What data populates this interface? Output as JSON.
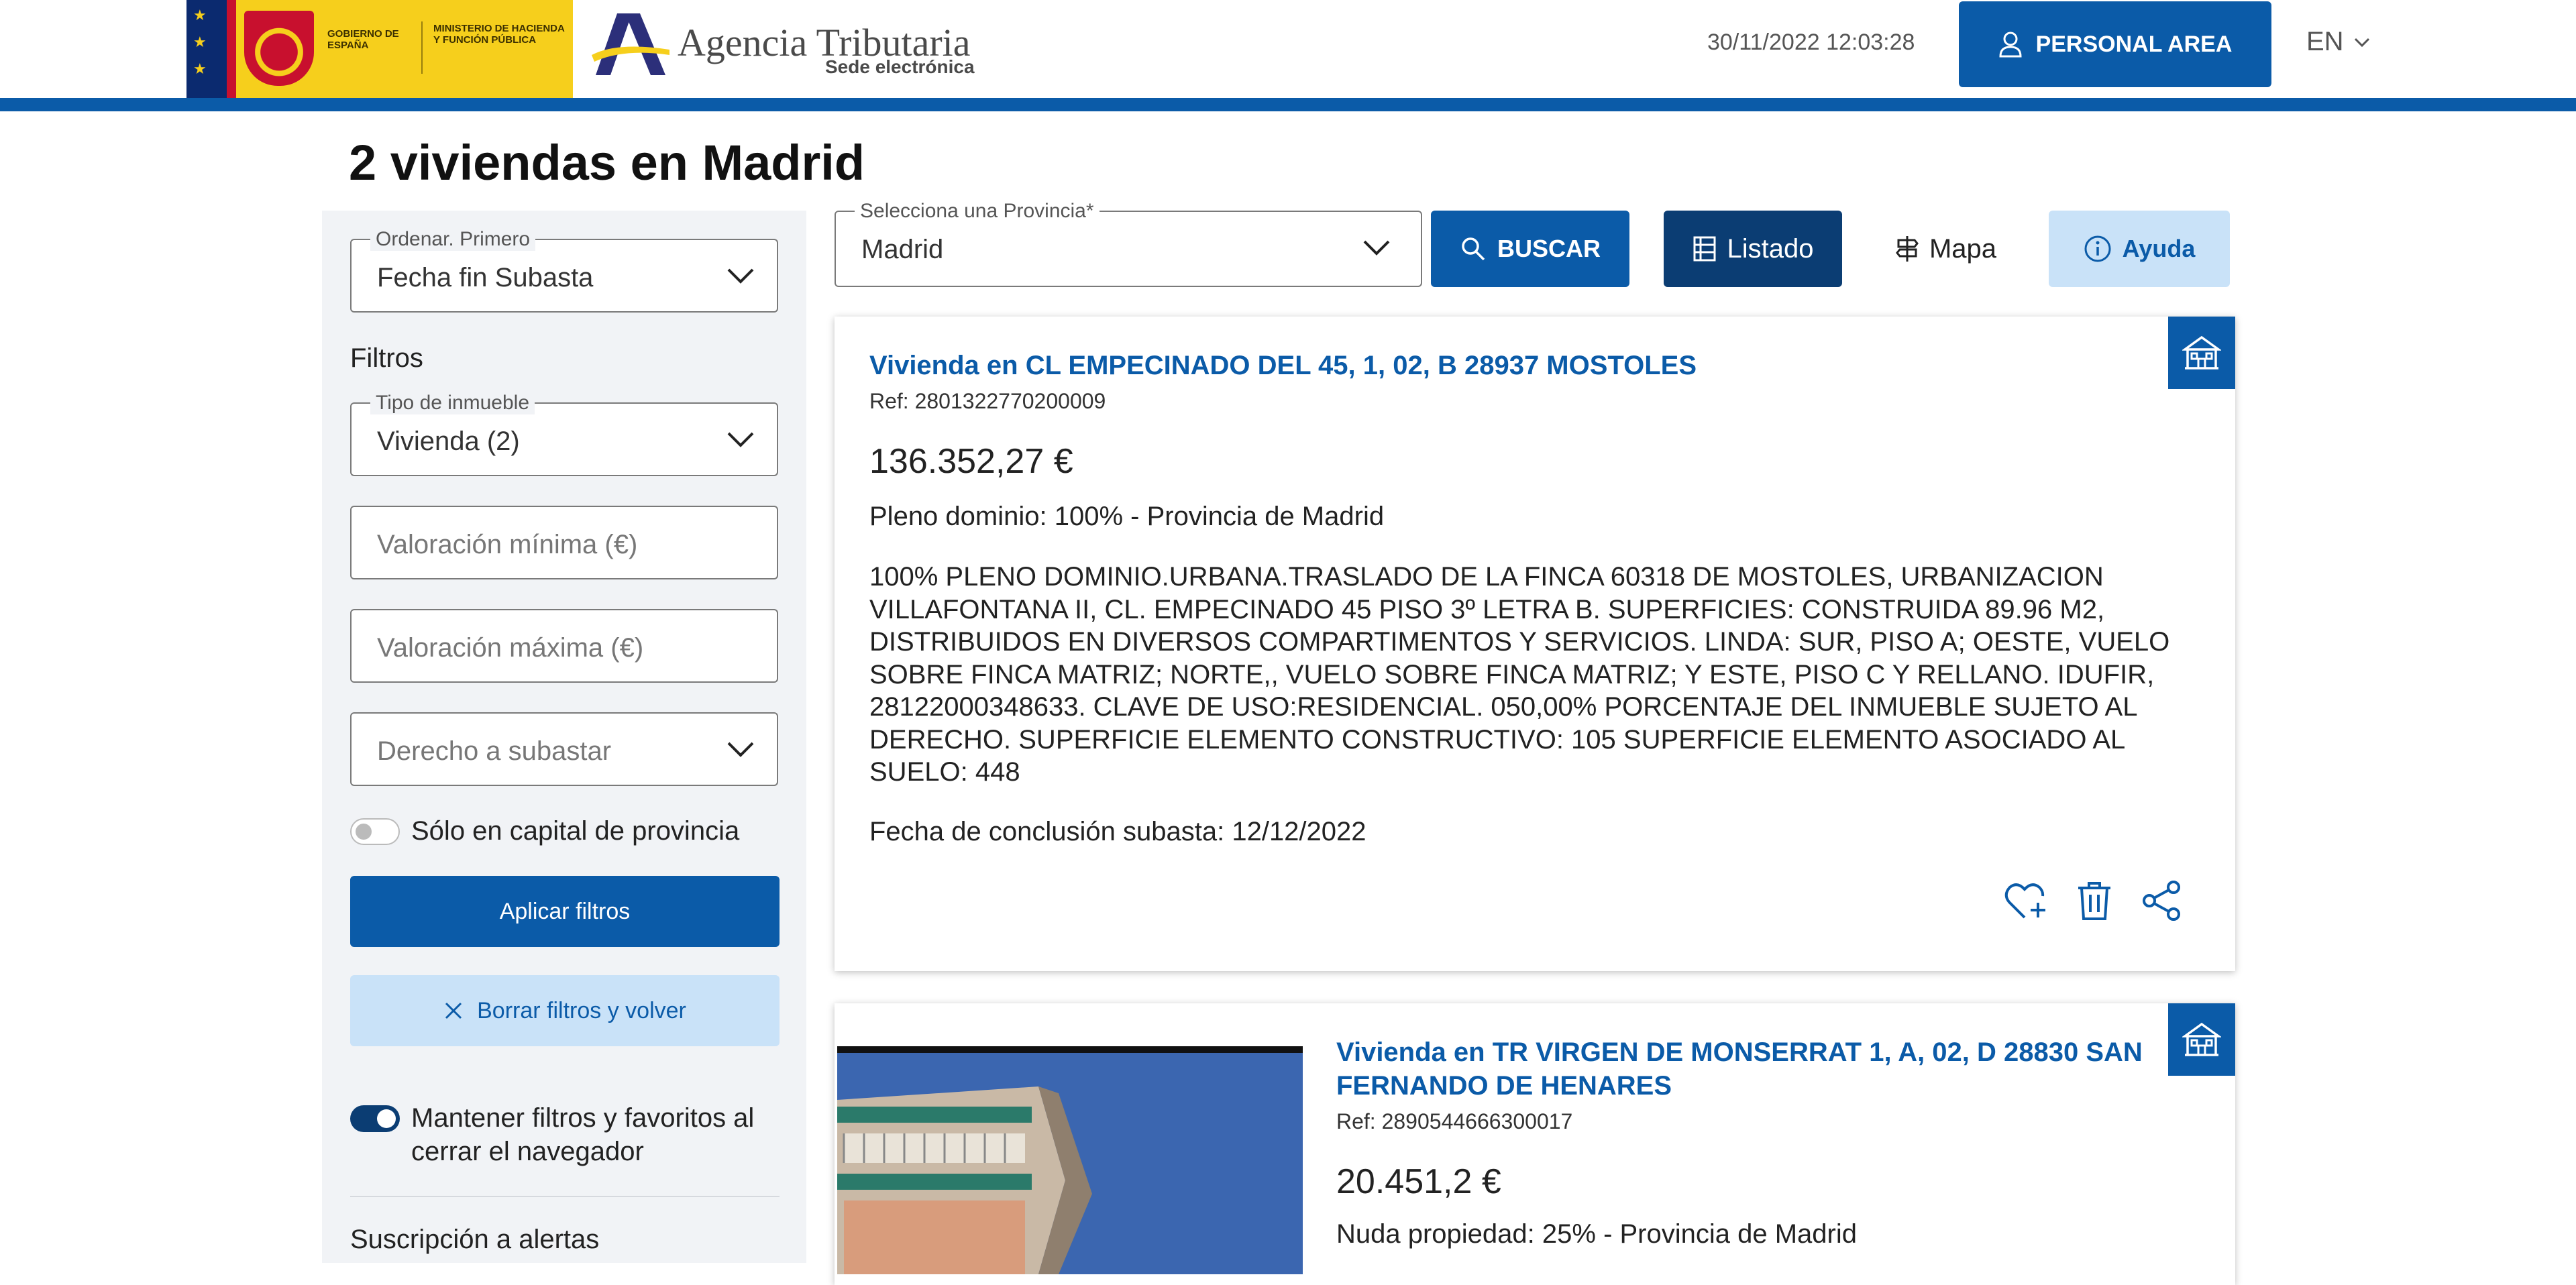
{
  "header": {
    "gob_text_1": "GOBIERNO DE ESPAÑA",
    "gob_text_2": "MINISTERIO DE HACIENDA Y FUNCIÓN PÚBLICA",
    "agency_name": "Agencia Tributaria",
    "agency_sub": "Sede electrónica",
    "datetime": "30/11/2022 12:03:28",
    "personal_area_label": "PERSONAL AREA",
    "language": "EN"
  },
  "page_title": "2 viviendas en Madrid",
  "sidebar": {
    "sort": {
      "legend": "Ordenar. Primero",
      "value": "Fecha fin Subasta"
    },
    "filters_label": "Filtros",
    "property_type": {
      "legend": "Tipo de inmueble",
      "value": "Vivienda (2)"
    },
    "min_valuation_placeholder": "Valoración mínima (€)",
    "max_valuation_placeholder": "Valoración máxima (€)",
    "right_placeholder": "Derecho a subastar",
    "capital_only_label": "Sólo en capital de provincia",
    "apply_label": "Aplicar filtros",
    "clear_label": "Borrar filtros y volver",
    "keep_filters_label": "Mantener filtros y favoritos al cerrar el navegador",
    "alerts_label": "Suscripción a alertas"
  },
  "toolbar": {
    "province_legend": "Selecciona una Provincia*",
    "province_value": "Madrid",
    "search_label": "BUSCAR",
    "list_label": "Listado",
    "map_label": "Mapa",
    "help_label": "Ayuda"
  },
  "listings": [
    {
      "title": "Vivienda en CL EMPECINADO DEL 45, 1, 02, B 28937 MOSTOLES",
      "ref": "Ref: 2801322770200009",
      "price": "136.352,27 €",
      "ownership": "Pleno dominio: 100% - Provincia de Madrid",
      "description": "100% PLENO DOMINIO.URBANA.TRASLADO DE LA FINCA 60318 DE MOSTOLES, URBANIZACION VILLAFONTANA II, CL. EMPECINADO 45 PISO 3º LETRA B. SUPERFICIES: CONSTRUIDA 89.96 M2, DISTRIBUIDOS EN DIVERSOS COMPARTIMENTOS Y SERVICIOS. LINDA: SUR, PISO A; OESTE, VUELO SOBRE FINCA MATRIZ; NORTE,, VUELO SOBRE FINCA MATRIZ; Y ESTE, PISO C Y RELLANO. IDUFIR, 28122000348633. CLAVE DE USO:RESIDENCIAL. 050,00% PORCENTAJE DEL INMUEBLE SUJETO AL DERECHO. SUPERFICIE ELEMENTO CONSTRUCTIVO: 105 SUPERFICIE ELEMENTO ASOCIADO AL SUELO: 448",
      "end_date": "Fecha de conclusión subasta: 12/12/2022"
    },
    {
      "title": "Vivienda en TR VIRGEN DE MONSERRAT 1, A, 02, D 28830 SAN FERNANDO DE HENARES",
      "ref": "Ref: 2890544666300017",
      "price": "20.451,2 €",
      "ownership": "Nuda propiedad: 25% - Provincia de Madrid"
    }
  ],
  "colors": {
    "primary": "#0b5ba8",
    "dark_primary": "#0b3d73",
    "light_primary": "#c9e2f8",
    "sidebar_bg": "#f1f3f6",
    "gob_yellow": "#f6cf1c"
  },
  "icons": {
    "user": "user-icon",
    "chevron": "chevron-down-icon",
    "search": "search-icon",
    "list": "list-icon",
    "map": "signpost-icon",
    "info": "info-icon",
    "close": "close-icon",
    "building": "building-icon",
    "favorite": "heart-plus-icon",
    "trash": "trash-icon",
    "share": "share-icon"
  }
}
